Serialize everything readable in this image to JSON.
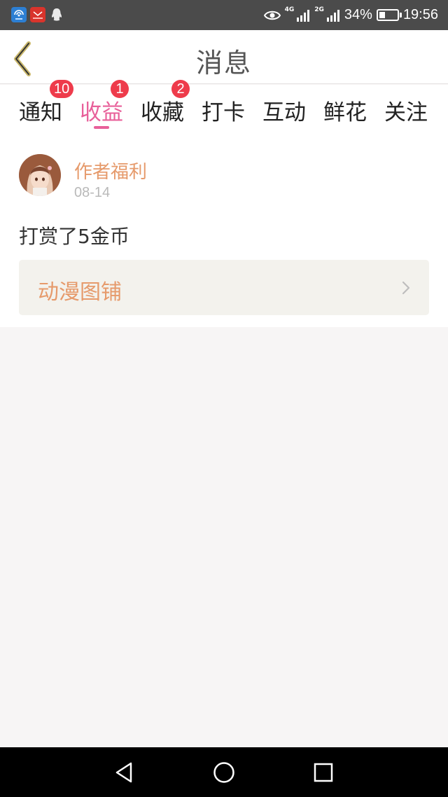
{
  "status_bar": {
    "network_4g": "4G",
    "network_2g": "2G",
    "battery_text": "34%",
    "battery_level": 0.34,
    "time": "19:56",
    "notification_icons": [
      "wifi-app-icon",
      "huawei-mail-icon",
      "qq-icon"
    ],
    "status_icons": [
      "eye-icon",
      "signal-icon",
      "signal-icon",
      "battery-icon"
    ]
  },
  "header": {
    "title": "消息",
    "back_icon": "chevron-left-icon"
  },
  "tabs": [
    {
      "label": "通知",
      "badge": "10",
      "active": false
    },
    {
      "label": "收益",
      "badge": "1",
      "active": true
    },
    {
      "label": "收藏",
      "badge": "2",
      "active": false
    },
    {
      "label": "打卡",
      "badge": null,
      "active": false
    },
    {
      "label": "互动",
      "badge": null,
      "active": false
    },
    {
      "label": "鲜花",
      "badge": null,
      "active": false
    },
    {
      "label": "关注",
      "badge": null,
      "active": false
    }
  ],
  "message": {
    "sender": "作者福利",
    "date": "08-14",
    "text": "打赏了5金币",
    "link_label": "动漫图铺",
    "link_icon": "chevron-right-icon"
  },
  "navbar": {
    "icons": [
      "back-triangle-icon",
      "home-circle-icon",
      "recents-square-icon"
    ]
  },
  "colors": {
    "accent": "#e8609a",
    "sender": "#e69a6b",
    "badge": "#ee3b4b",
    "page_background": "#f7f5f5",
    "status_bar": "#4b4b4b"
  }
}
